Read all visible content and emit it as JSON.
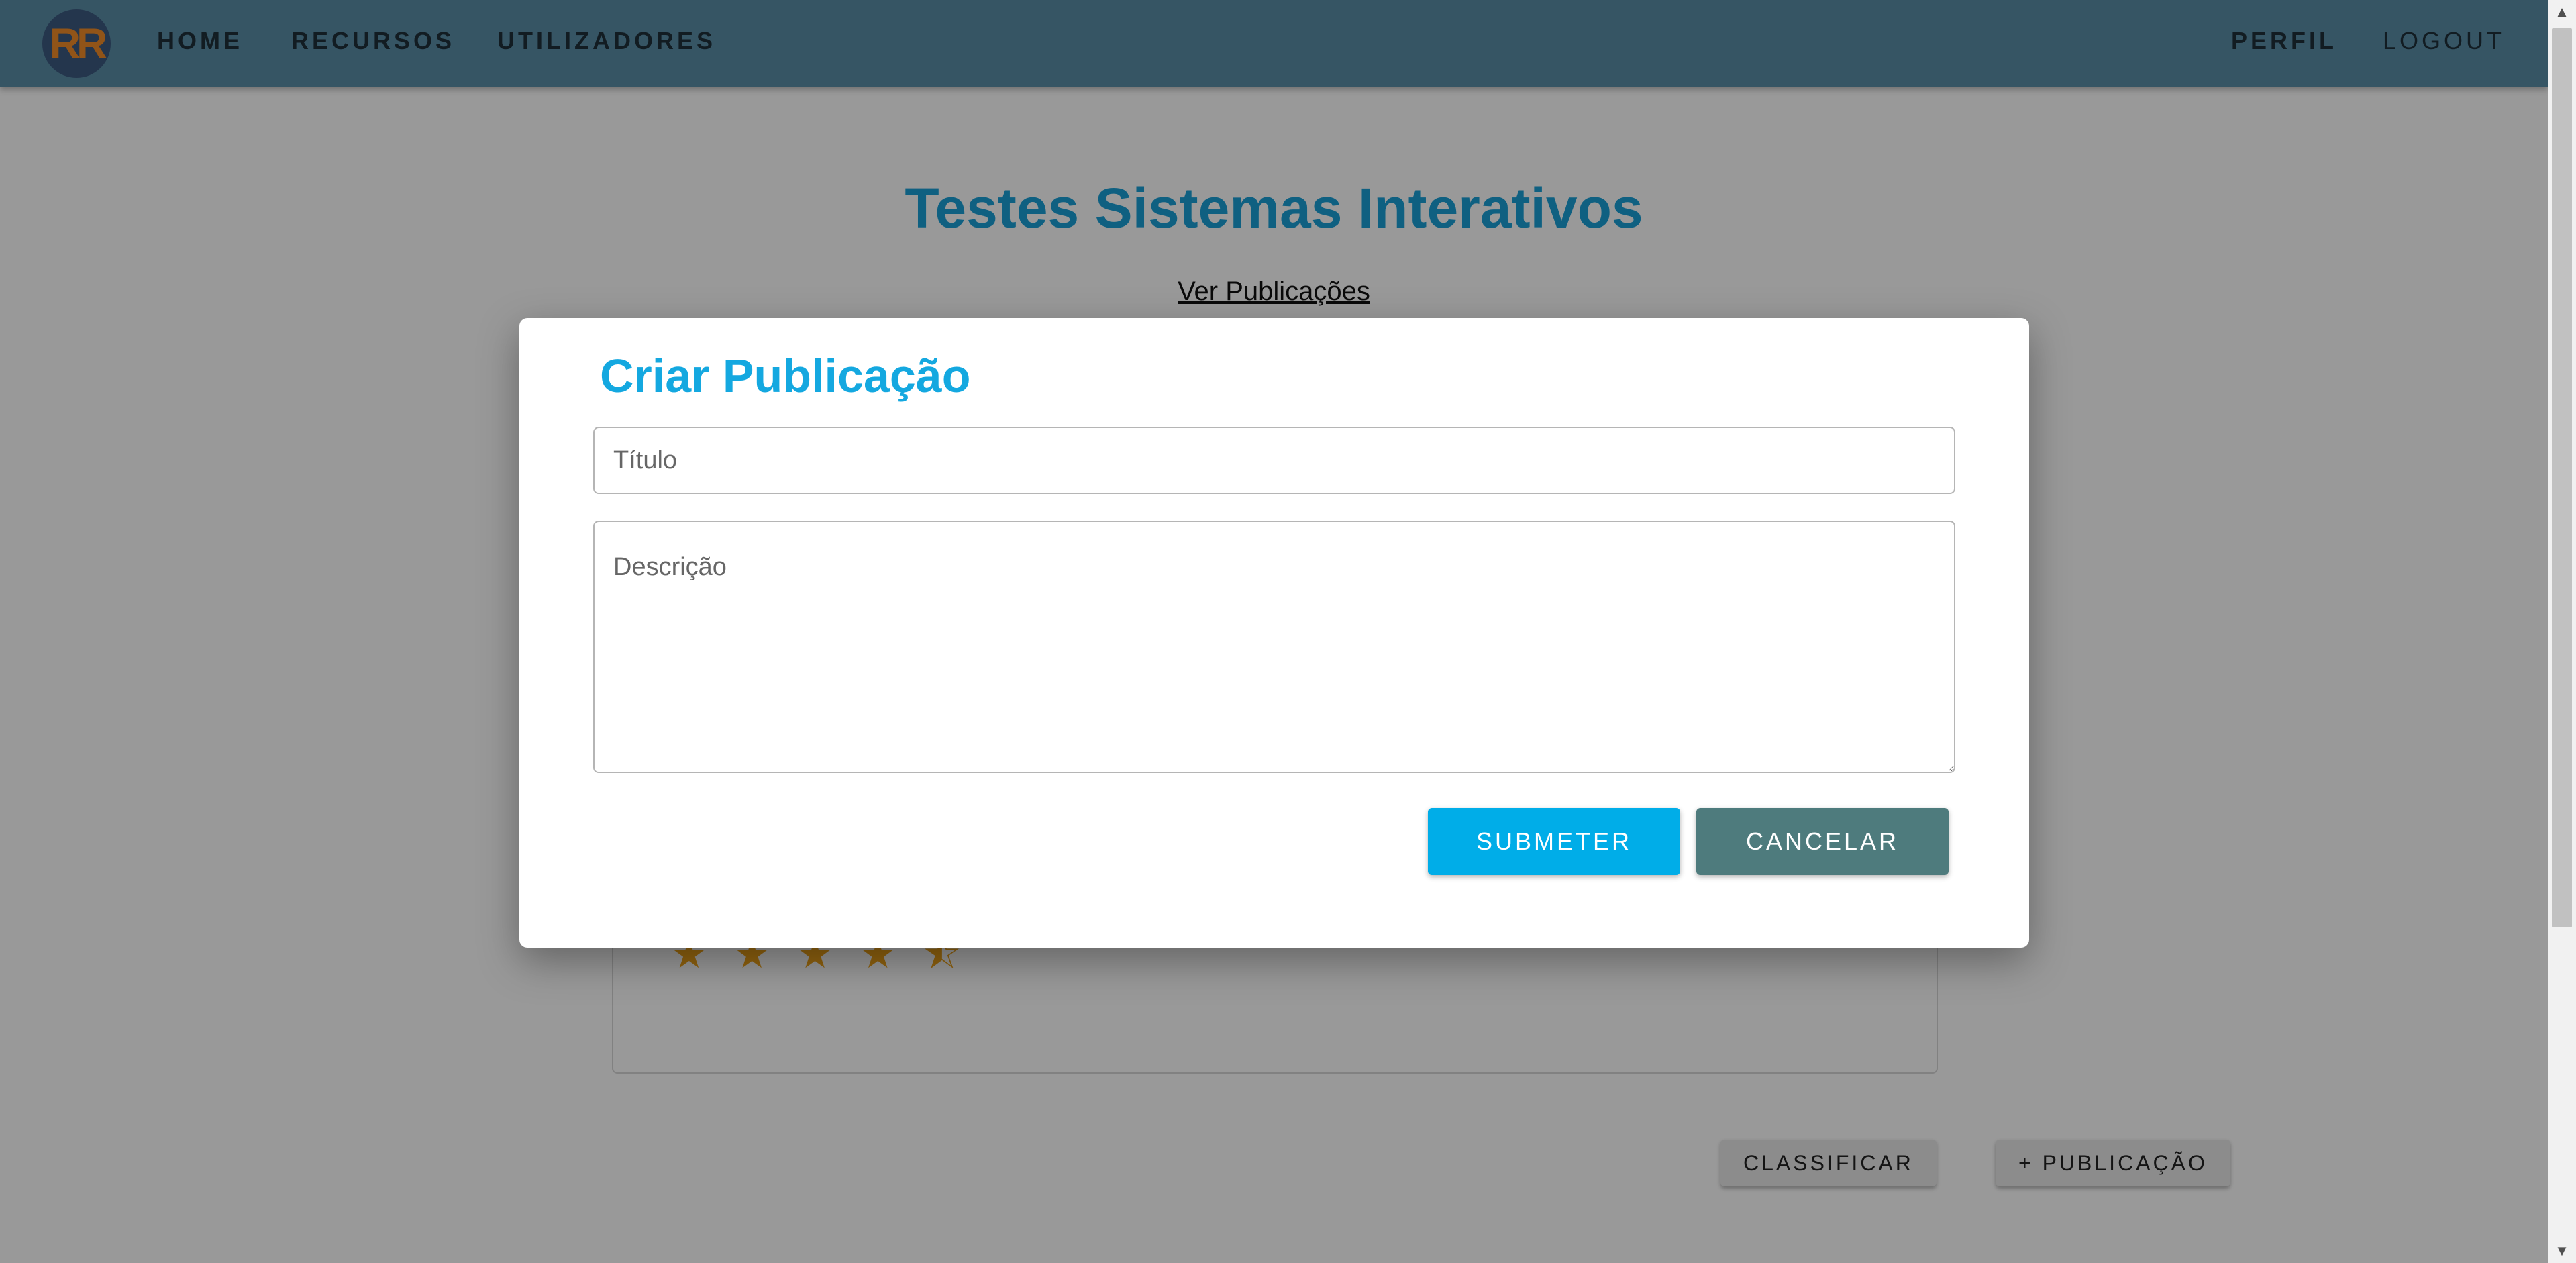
{
  "navbar": {
    "logo_text": "RR",
    "items": [
      {
        "label": "HOME"
      },
      {
        "label": "RECURSOS"
      },
      {
        "label": "UTILIZADORES"
      }
    ],
    "right_items": [
      {
        "label": "PERFIL"
      },
      {
        "label": "LOGOUT"
      }
    ]
  },
  "page": {
    "title": "Testes Sistemas Interativos",
    "link": "Ver Publicações",
    "rating": 4.5,
    "rating_stars": "★★★★⯪",
    "buttons": {
      "classify": "CLASSIFICAR",
      "add_post": "+ PUBLICAÇÃO"
    }
  },
  "modal": {
    "title": "Criar Publicação",
    "title_placeholder": "Título",
    "title_value": "",
    "description_placeholder": "Descrição",
    "description_value": "",
    "submit_label": "SUBMETER",
    "cancel_label": "CANCELAR"
  },
  "colors": {
    "navbar": "#5a8ea7",
    "page_title": "#1aa0d8",
    "modal_title": "#14a8e0",
    "submit": "#00ade8",
    "cancel": "#4e7b7d",
    "stars": "#f2a51a"
  }
}
